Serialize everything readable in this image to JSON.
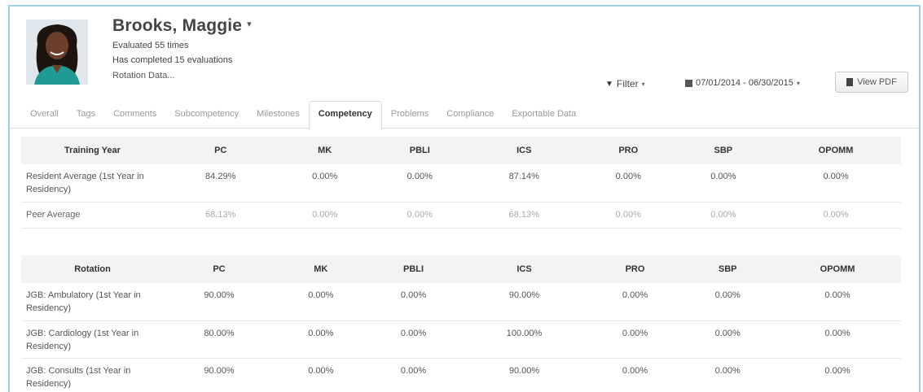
{
  "profile": {
    "name": "Brooks, Maggie",
    "evaluated": "Evaluated 55 times",
    "completed": "Has completed 15 evaluations",
    "rotation_link": "Rotation Data..."
  },
  "toolbar": {
    "filter_label": "Filter",
    "date_range": "07/01/2014 - 06/30/2015",
    "view_pdf": "View PDF"
  },
  "tabs": [
    {
      "label": "Overall"
    },
    {
      "label": "Tags"
    },
    {
      "label": "Comments"
    },
    {
      "label": "Subcompetency"
    },
    {
      "label": "Milestones"
    },
    {
      "label": "Competency",
      "active": true
    },
    {
      "label": "Problems"
    },
    {
      "label": "Compliance"
    },
    {
      "label": "Exportable Data"
    }
  ],
  "training_table": {
    "headers": [
      "Training Year",
      "PC",
      "MK",
      "PBLI",
      "ICS",
      "PRO",
      "SBP",
      "OPOMM"
    ],
    "rows": [
      {
        "label": "Resident Average (1st Year in Residency)",
        "values": [
          "84.29%",
          "0.00%",
          "0.00%",
          "87.14%",
          "0.00%",
          "0.00%",
          "0.00%"
        ]
      },
      {
        "label": "Peer Average",
        "values": [
          "68.13%",
          "0.00%",
          "0.00%",
          "68.13%",
          "0.00%",
          "0.00%",
          "0.00%"
        ]
      }
    ]
  },
  "rotation_table": {
    "headers": [
      "Rotation",
      "PC",
      "MK",
      "PBLI",
      "ICS",
      "PRO",
      "SBP",
      "OPOMM"
    ],
    "rows": [
      {
        "label": "JGB: Ambulatory (1st Year in Residency)",
        "values": [
          "90.00%",
          "0.00%",
          "0.00%",
          "90.00%",
          "0.00%",
          "0.00%",
          "0.00%"
        ]
      },
      {
        "label": "JGB: Cardiology (1st Year in Residency)",
        "values": [
          "80.00%",
          "0.00%",
          "0.00%",
          "100.00%",
          "0.00%",
          "0.00%",
          "0.00%"
        ]
      },
      {
        "label": "JGB: Consults (1st Year in Residency)",
        "values": [
          "90.00%",
          "0.00%",
          "0.00%",
          "90.00%",
          "0.00%",
          "0.00%",
          "0.00%"
        ]
      }
    ]
  },
  "colors": {
    "frame_border": "#9fd0e6",
    "header_bg": "#f3f3f3"
  }
}
